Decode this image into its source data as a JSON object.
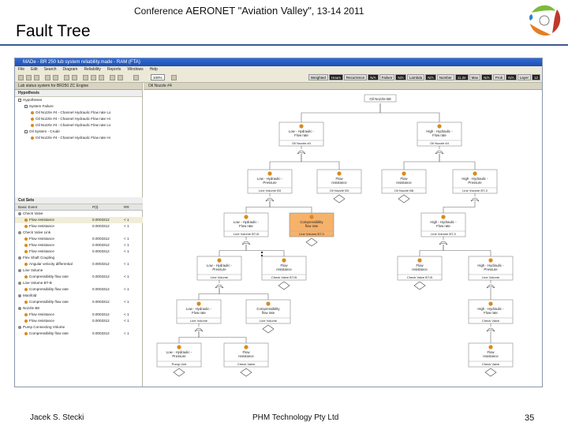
{
  "header": {
    "conference_prefix": "Conference",
    "conference_name": "AERONET \"Aviation Valley\"",
    "conference_dates": ", 13-14 2011",
    "slide_title": "Fault Tree"
  },
  "footer": {
    "author": "Jacek S. Stecki",
    "company": "PHM Technology Pty Ltd",
    "page_number": "35"
  },
  "app": {
    "window_title": "MADe - BR 250 lub system reliability.made - RAM (FTA)",
    "menu": [
      "File",
      "Edit",
      "Search",
      "Diagram",
      "Reliability",
      "Reports",
      "Windows",
      "Help"
    ],
    "zoom": "100%",
    "status_cells": [
      {
        "label": "Weighted",
        "dark": false
      },
      {
        "label": "Hours",
        "dark": true
      },
      {
        "label": "Recurrence",
        "dark": false
      },
      {
        "label": "N/A",
        "dark": true
      },
      {
        "label": "Failure",
        "dark": false
      },
      {
        "label": "N/A",
        "dark": true
      },
      {
        "label": "Lambda",
        "dark": false
      },
      {
        "label": "N/A",
        "dark": true
      },
      {
        "label": "Number",
        "dark": false
      },
      {
        "label": "11.2e",
        "dark": true
      },
      {
        "label": "Max",
        "dark": false
      },
      {
        "label": "N/A",
        "dark": true
      },
      {
        "label": "Prob",
        "dark": false
      },
      {
        "label": "N/A",
        "dark": true
      },
      {
        "label": "Layer",
        "dark": false
      },
      {
        "label": "12",
        "dark": true
      }
    ],
    "left_tab": "Lub status system for BR250 ZC Engine",
    "editor_tab": "Oil Nozzle #4",
    "hypotheses_title": "Hypothesis",
    "tree": [
      {
        "indent": 0,
        "label": "Hypotheses",
        "kind": "box"
      },
      {
        "indent": 1,
        "label": "System Failure",
        "kind": "box"
      },
      {
        "indent": 2,
        "label": "Oil Nozzle #4 - Channel Hydraulic Flow rate Lo",
        "kind": "dot"
      },
      {
        "indent": 2,
        "label": "Oil Nozzle #4 - Channel Hydraulic Flow rate Hi",
        "kind": "dot"
      },
      {
        "indent": 2,
        "label": "Oil Nozzle #4 - Channel Hydraulic Flow rate Lo",
        "kind": "dot"
      },
      {
        "indent": 1,
        "label": "Oil System - Crude",
        "kind": "box"
      },
      {
        "indent": 2,
        "label": "Oil Nozzle #4 - Channel Hydraulic Flow rate Hi",
        "kind": "dot"
      }
    ],
    "cutsets_title": "Cut Sets",
    "cut_columns": [
      "Basic Event",
      "P(t)",
      "RR"
    ],
    "cut_rows": [
      {
        "label": "Check Valve",
        "p": "",
        "r": "",
        "indent": 0,
        "sel": false
      },
      {
        "label": "Flow resistance",
        "p": "0.0003312",
        "r": "< 1",
        "indent": 1,
        "sel": true
      },
      {
        "label": "Flow resistance",
        "p": "0.0003312",
        "r": "< 1",
        "indent": 1,
        "sel": false
      },
      {
        "label": "Check Valve Link",
        "p": "",
        "r": "",
        "indent": 0,
        "sel": false
      },
      {
        "label": "Flow resistance",
        "p": "0.0003312",
        "r": "< 1",
        "indent": 1,
        "sel": false
      },
      {
        "label": "Flow resistance",
        "p": "0.0003312",
        "r": "< 1",
        "indent": 1,
        "sel": false
      },
      {
        "label": "Flow resistance",
        "p": "0.0003312",
        "r": "< 1",
        "indent": 1,
        "sel": false
      },
      {
        "label": "Flex Shaft Coupling",
        "p": "",
        "r": "",
        "indent": 0,
        "sel": false
      },
      {
        "label": "Angular velocity differential",
        "p": "0.0003312",
        "r": "< 1",
        "indent": 1,
        "sel": false
      },
      {
        "label": "Line Volume",
        "p": "",
        "r": "",
        "indent": 0,
        "sel": false
      },
      {
        "label": "Compressibility flow rate",
        "p": "0.0003312",
        "r": "< 1",
        "indent": 1,
        "sel": false
      },
      {
        "label": "Line Volume BT-B",
        "p": "",
        "r": "",
        "indent": 0,
        "sel": false
      },
      {
        "label": "Compressibility flow rate",
        "p": "0.0003312",
        "r": "< 1",
        "indent": 1,
        "sel": false
      },
      {
        "label": "Manifold",
        "p": "",
        "r": "",
        "indent": 0,
        "sel": false
      },
      {
        "label": "Compressibility flow rate",
        "p": "0.0003312",
        "r": "< 1",
        "indent": 1,
        "sel": false
      },
      {
        "label": "Nozzle B8",
        "p": "",
        "r": "",
        "indent": 0,
        "sel": false
      },
      {
        "label": "Flow resistance",
        "p": "0.0003312",
        "r": "< 1",
        "indent": 1,
        "sel": false
      },
      {
        "label": "Flow resistance",
        "p": "0.0003312",
        "r": "< 1",
        "indent": 1,
        "sel": false
      },
      {
        "label": "Pump Connecting Volume",
        "p": "",
        "r": "",
        "indent": 0,
        "sel": false
      },
      {
        "label": "Compressibility flow rate",
        "p": "0.0003312",
        "r": "< 1",
        "indent": 1,
        "sel": false
      }
    ],
    "fault_tree": {
      "top": "Oil Nozzle B8",
      "nodes": [
        {
          "id": "n1",
          "title": "Low - Hydraulic - Flow rate",
          "sub": "Oil Nozzle #4",
          "highlight": false
        },
        {
          "id": "n2",
          "title": "High - Hydraulic - Flow rate",
          "sub": "Oil Nozzle #4",
          "highlight": false
        },
        {
          "id": "n3",
          "title": "Low - Hydraulic - Pressure",
          "sub": "Line Volume B3",
          "highlight": false
        },
        {
          "id": "n4",
          "title": "Flow resistance",
          "sub": "Oil Nozzle B3",
          "highlight": false
        },
        {
          "id": "n5",
          "title": "Flow resistance",
          "sub": "Oil Nozzle B8",
          "highlight": false
        },
        {
          "id": "n6",
          "title": "High - Hydraulic - Pressure",
          "sub": "Line Volume BT-3",
          "highlight": false
        },
        {
          "id": "n7",
          "title": "Low - Hydraulic - Flow rate",
          "sub": "Line Volume BT-B",
          "highlight": false
        },
        {
          "id": "n8",
          "title": "Compressibility flow rate",
          "sub": "Line Volume BT-3",
          "highlight": true
        },
        {
          "id": "n9",
          "title": "High - Hydraulic - Flow rate",
          "sub": "Line Volume BT-3",
          "highlight": false
        },
        {
          "id": "n10",
          "title": "Low - Hydraulic - Pressure",
          "sub": "Line Volume",
          "highlight": false
        },
        {
          "id": "n11",
          "title": "Flow resistance",
          "sub": "Check Valve BT-B",
          "highlight": false
        },
        {
          "id": "n12",
          "title": "Flow resistance",
          "sub": "Check Valve BT-B",
          "highlight": false
        },
        {
          "id": "n13",
          "title": "High - Hydraulic - Pressure",
          "sub": "Line Volume",
          "highlight": false
        },
        {
          "id": "n14",
          "title": "Low - Hydraulic - Flow rate",
          "sub": "Line Volume",
          "highlight": false
        },
        {
          "id": "n15",
          "title": "Compressibility flow rate",
          "sub": "Line Volume",
          "highlight": false
        },
        {
          "id": "n16",
          "title": "High - Hydraulic - Flow rate",
          "sub": "Check Valve",
          "highlight": false
        },
        {
          "id": "n17",
          "title": "Low - Hydraulic - Pressure",
          "sub": "Pump Unit",
          "highlight": false
        },
        {
          "id": "n18",
          "title": "Flow resistance",
          "sub": "Check Valve",
          "highlight": false
        },
        {
          "id": "n19",
          "title": "Flow resistance",
          "sub": "Check Valve",
          "highlight": false
        }
      ]
    }
  },
  "colors": {
    "rule": "#3b5b96",
    "node_icon": "#d98a1f",
    "highlight": "#f6b26b",
    "logo_green": "#7dbb3a",
    "logo_red": "#c0392b"
  }
}
